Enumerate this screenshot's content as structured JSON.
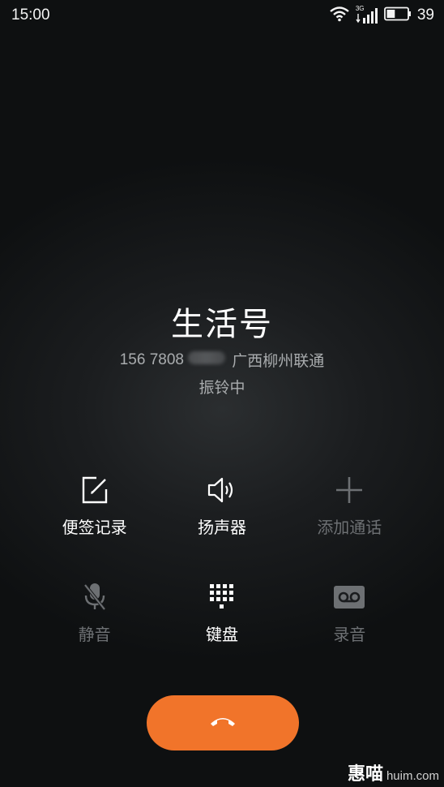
{
  "status_bar": {
    "time": "15:00",
    "network_label": "3G",
    "battery_percent": "39",
    "battery_level": 0.39
  },
  "caller": {
    "name": "生活号",
    "number": "156 7808",
    "location": "广西柳州联通",
    "status": "振铃中"
  },
  "controls": [
    [
      {
        "label": "便签记录",
        "icon": "note-edit-icon",
        "enabled": true
      },
      {
        "label": "扬声器",
        "icon": "speaker-icon",
        "enabled": true
      },
      {
        "label": "添加通话",
        "icon": "plus-icon",
        "enabled": false
      }
    ],
    [
      {
        "label": "静音",
        "icon": "microphone-mute-icon",
        "enabled": false
      },
      {
        "label": "键盘",
        "icon": "dialpad-icon",
        "enabled": true
      },
      {
        "label": "录音",
        "icon": "record-tape-icon",
        "enabled": false
      }
    ]
  ],
  "hangup": {
    "icon": "hang-up-phone-icon",
    "color": "#f1742a"
  },
  "watermark": {
    "main": "惠喵",
    "sub": "huim.com"
  },
  "colors": {
    "enabled": "#ffffff",
    "disabled": "#6d7073",
    "hangup": "#f1742a"
  }
}
